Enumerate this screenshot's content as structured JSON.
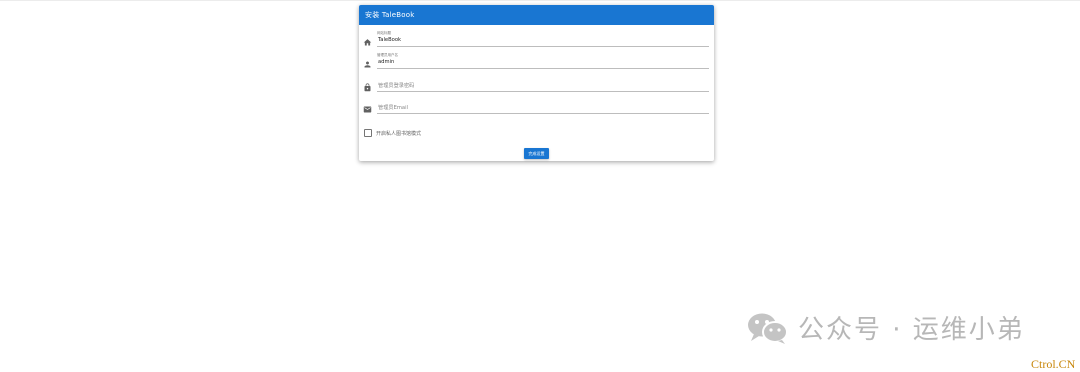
{
  "header": {
    "title": "安装 TaleBook"
  },
  "form": {
    "site_title": {
      "label": "网站标题",
      "value": "TaleBook",
      "icon": "home-icon"
    },
    "admin_user": {
      "label": "管理员用户名",
      "value": "admin",
      "icon": "person-icon"
    },
    "admin_password": {
      "placeholder": "管理员登录密码",
      "icon": "lock-icon"
    },
    "admin_email": {
      "placeholder": "管理员Email",
      "icon": "email-icon"
    },
    "private_mode": {
      "label": "开启私人图书馆模式",
      "checked": false
    },
    "submit_label": "完成设置"
  },
  "watermark": {
    "text": "公众号 · 运维小弟",
    "icon": "wechat-icon"
  },
  "corner_mark": "Ctrol.CN",
  "colors": {
    "primary": "#1976d2",
    "watermark": "#b7b7b7",
    "corner_mark": "#c8870b"
  }
}
